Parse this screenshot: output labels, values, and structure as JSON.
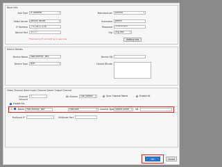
{
  "basic_info": {
    "title": "Basic Info",
    "add_type_label": "Add Type",
    "add_type_value": "IP Address",
    "manufacturer_label": "Manufacturer",
    "manufacturer_value": "DAHUA",
    "video_server_label": "Video Server",
    "video_server_value": "Device Server",
    "username_label": "Username",
    "username_value": "admin",
    "ip_label": "IP Address",
    "ip_value": "172.16.17.176",
    "password_label": "Password",
    "password_value": "••••••••••",
    "device_port_label": "Device Port",
    "device_port_value": "37777",
    "org_label": "Org",
    "org_value": "Org Hall",
    "get_info_label": "Getting Info",
    "warning": "The device IP and port is in use now."
  },
  "device_details": {
    "title": "Device Details",
    "device_name_label": "Device Name",
    "device_name_value": "Pool overlay ,dev",
    "device_sn_label": "Device SN",
    "device_sn_value": "",
    "device_type_label": "Device Type",
    "device_type_value": "NVR",
    "device_bitrate_label": "Device Bitrate",
    "device_bitrate_value": ""
  },
  "channels": {
    "tabs_label": "Video Channel   Alarm Input Channel   Alarm Output Channel",
    "channel_amount_label": "Channel Amount",
    "channel_amount_value": "1",
    "bit_stream_label": "Bit Stream",
    "bit_stream_value": "Sub Stream",
    "sync_channel_name_label": "Sync Channel Name",
    "enable_all_label": "Enable All",
    "enable_label": "Enable ALL",
    "row": {
      "index": "1",
      "name_label": "Name",
      "name_value": "Pool overlay ,dev",
      "feature_label": "Features",
      "feature_value": "",
      "camera_type_label": "Camera Type",
      "camera_type_value": "Speed Dome",
      "sn_label": "SN",
      "sn_value": ""
    },
    "multicast_ip_label": "Multicast IP",
    "multicast_port_label": "Multicast Port"
  },
  "footer": {
    "ok_label": "OK",
    "cancel_label": "Cancel"
  }
}
